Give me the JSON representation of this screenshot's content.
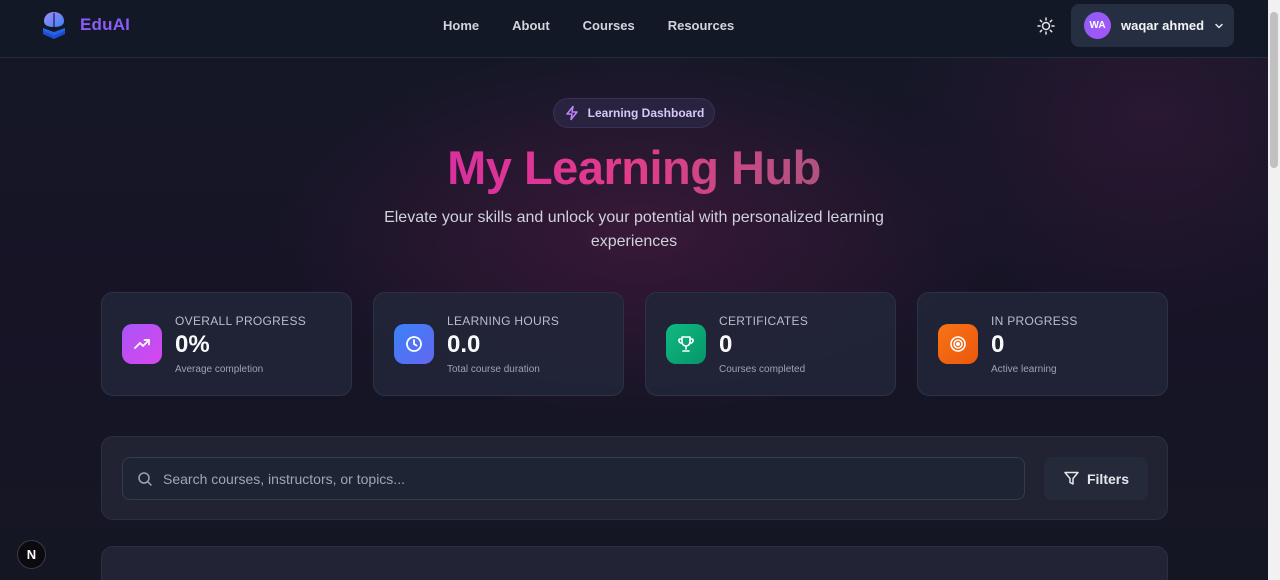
{
  "brand": {
    "name": "EduAI",
    "accent": "#8b5cf6"
  },
  "nav": {
    "links": [
      {
        "label": "Home"
      },
      {
        "label": "About"
      },
      {
        "label": "Courses"
      },
      {
        "label": "Resources"
      }
    ],
    "theme_icon": "sun-icon",
    "user": {
      "initials": "WA",
      "name": "waqar ahmed"
    }
  },
  "hero": {
    "badge": "Learning Dashboard",
    "title": "My Learning Hub",
    "subtitle": "Elevate your skills and unlock your potential with personalized learning experiences"
  },
  "stats": [
    {
      "label": "OVERALL PROGRESS",
      "value": "0%",
      "sub": "Average completion",
      "icon": "trending-up-icon",
      "color": "#a855f7"
    },
    {
      "label": "LEARNING HOURS",
      "value": "0.0",
      "sub": "Total course duration",
      "icon": "clock-icon",
      "color": "#3b82f6"
    },
    {
      "label": "CERTIFICATES",
      "value": "0",
      "sub": "Courses completed",
      "icon": "trophy-icon",
      "color": "#10b981"
    },
    {
      "label": "IN PROGRESS",
      "value": "0",
      "sub": "Active learning",
      "icon": "target-icon",
      "color": "#f97316"
    }
  ],
  "search": {
    "placeholder": "Search courses, instructors, or topics...",
    "filters_label": "Filters"
  },
  "dev_badge": "N"
}
